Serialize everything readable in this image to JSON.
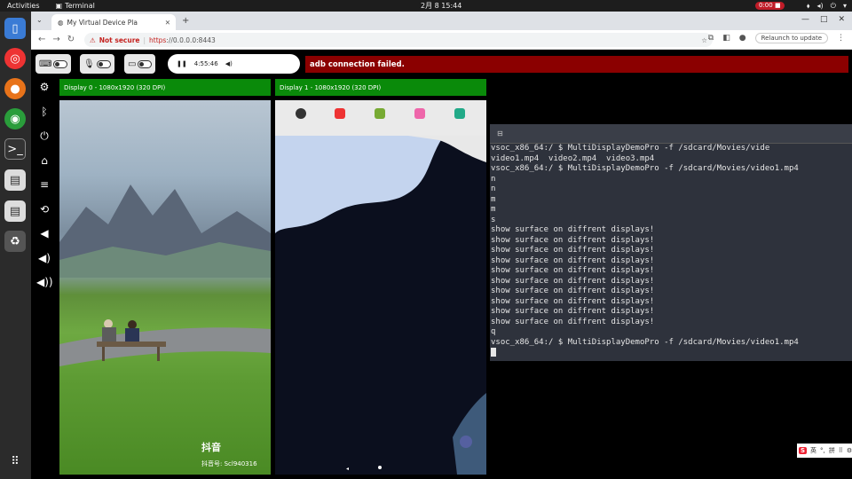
{
  "topbar": {
    "activities": "Activities",
    "app_name": "Terminal",
    "clock": "2月 8  15:44",
    "record": "0:00"
  },
  "browser": {
    "tab_title": "My Virtual Device Pla",
    "not_secure": "Not secure",
    "url_scheme": "https",
    "url_rest": "://0.0.0.0:8443",
    "relaunch": "Relaunch to update"
  },
  "page": {
    "player_time": "4:55:46",
    "error": "adb connection failed.",
    "display0_label": "Display 0 - 1080x1920 (320 DPI)",
    "display1_label": "Display 1 - 1080x1920 (320 DPI)",
    "watermark_logo": "抖音",
    "watermark_id": "抖音号: Scl940316"
  },
  "terminal": {
    "lines": [
      "vsoc_x86_64:/ $ MultiDisplayDemoPro -f /sdcard/Movies/vide",
      "video1.mp4  video2.mp4  video3.mp4",
      "vsoc_x86_64:/ $ MultiDisplayDemoPro -f /sdcard/Movies/video1.mp4",
      "n",
      "n",
      "m",
      "m",
      "s",
      "show surface on diffrent displays!",
      "show surface on diffrent displays!",
      "show surface on diffrent displays!",
      "show surface on diffrent displays!",
      "show surface on diffrent displays!",
      "show surface on diffrent displays!",
      "show surface on diffrent displays!",
      "show surface on diffrent displays!",
      "show surface on diffrent displays!",
      "show surface on diffrent displays!",
      "q",
      "vsoc_x86_64:/ $ MultiDisplayDemoPro -f /sdcard/Movies/video1.mp4"
    ]
  },
  "ime": {
    "logo": "S",
    "mode": "英",
    "pinyin": "拼"
  },
  "colors": {
    "error_bg": "#8b0000",
    "display_label_bg": "#0a8a0a",
    "terminal_bg": "#2e323c"
  }
}
